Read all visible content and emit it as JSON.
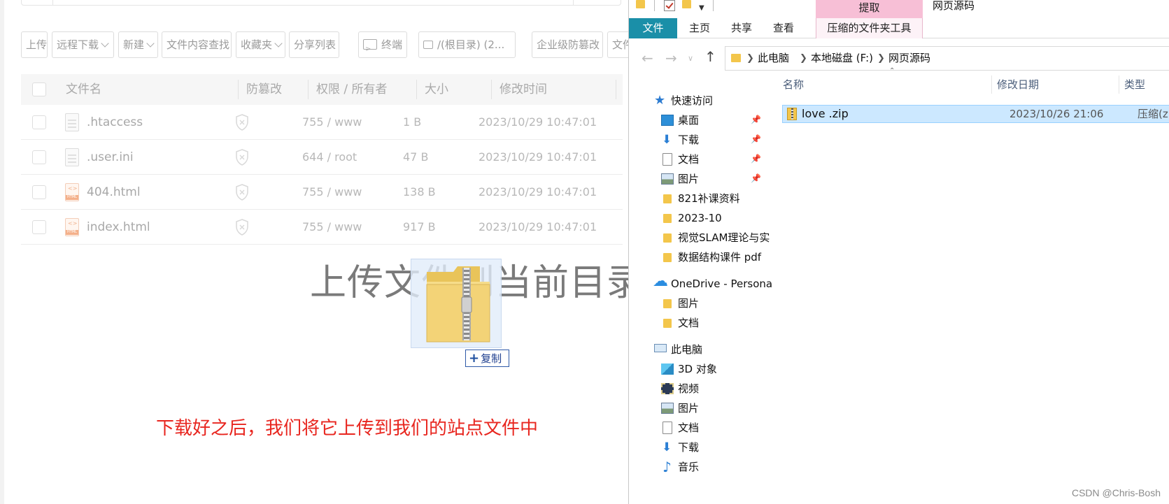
{
  "file_manager": {
    "toolbar": [
      {
        "label": "上传",
        "dropdown": false
      },
      {
        "label": "远程下载",
        "dropdown": true
      },
      {
        "label": "新建",
        "dropdown": true
      },
      {
        "label": "文件内容查找",
        "dropdown": false
      },
      {
        "label": "收藏夹",
        "dropdown": true
      },
      {
        "label": "分享列表",
        "dropdown": false
      },
      {
        "label": "终端",
        "icon": "terminal-icon"
      },
      {
        "label": "/(根目录) (2...",
        "icon": "disk-icon"
      },
      {
        "label": "企业级防篡改",
        "dropdown": false
      },
      {
        "label": "文件",
        "dropdown": false
      }
    ],
    "columns": {
      "name": "文件名",
      "tamper": "防篡改",
      "perm": "权限 / 所有者",
      "size": "大小",
      "mtime": "修改时间"
    },
    "files": [
      {
        "name": ".htaccess",
        "icon": "text-file-icon",
        "perm": "755 / www",
        "size": "1 B",
        "mtime": "2023/10/29 10:47:01"
      },
      {
        "name": ".user.ini",
        "icon": "text-file-icon",
        "perm": "644 / root",
        "size": "47 B",
        "mtime": "2023/10/29 10:47:01"
      },
      {
        "name": "404.html",
        "icon": "html-file-icon",
        "perm": "755 / www",
        "size": "138 B",
        "mtime": "2023/10/29 10:47:01"
      },
      {
        "name": "index.html",
        "icon": "html-file-icon",
        "perm": "755 / www",
        "size": "917 B",
        "mtime": "2023/10/29 10:47:01"
      }
    ],
    "drop_overlay_text": "上传文件到当前目录下",
    "copy_tip": "复制"
  },
  "annotation": "下载好之后，我们将它上传到我们的站点文件中",
  "explorer": {
    "window_title": "网页源码",
    "context_tab": "提取",
    "ribbon_tabs": [
      "文件",
      "主页",
      "共享",
      "查看",
      "压缩的文件夹工具"
    ],
    "breadcrumb": [
      "此电脑",
      "本地磁盘 (F:)",
      "网页源码"
    ],
    "nav": [
      {
        "label": "快速访问",
        "icon": "star-icon"
      },
      {
        "label": "桌面",
        "icon": "desktop-icon",
        "pinned": true
      },
      {
        "label": "下载",
        "icon": "download-icon",
        "pinned": true
      },
      {
        "label": "文档",
        "icon": "document-icon",
        "pinned": true
      },
      {
        "label": "图片",
        "icon": "picture-icon",
        "pinned": true
      },
      {
        "label": "821补课资料",
        "icon": "folder-icon"
      },
      {
        "label": "2023-10",
        "icon": "folder-icon"
      },
      {
        "label": "视觉SLAM理论与实",
        "icon": "folder-icon"
      },
      {
        "label": "数据结构课件 pdf",
        "icon": "folder-icon"
      },
      {
        "label": "OneDrive - Persona",
        "icon": "onedrive-icon"
      },
      {
        "label": "图片",
        "icon": "folder-icon"
      },
      {
        "label": "文档",
        "icon": "folder-icon"
      },
      {
        "label": "此电脑",
        "icon": "pc-icon"
      },
      {
        "label": "3D 对象",
        "icon": "3d-objects-icon"
      },
      {
        "label": "视频",
        "icon": "video-icon"
      },
      {
        "label": "图片",
        "icon": "picture-icon"
      },
      {
        "label": "文档",
        "icon": "document-icon"
      },
      {
        "label": "下载",
        "icon": "download-icon"
      },
      {
        "label": "音乐",
        "icon": "music-icon"
      }
    ],
    "columns": {
      "name": "名称",
      "date": "修改日期",
      "type": "类型"
    },
    "files": [
      {
        "name": "love .zip",
        "date": "2023/10/26 21:06",
        "type": "压缩(zi",
        "selected": true
      }
    ]
  },
  "watermark": "CSDN @Chris-Bosh"
}
